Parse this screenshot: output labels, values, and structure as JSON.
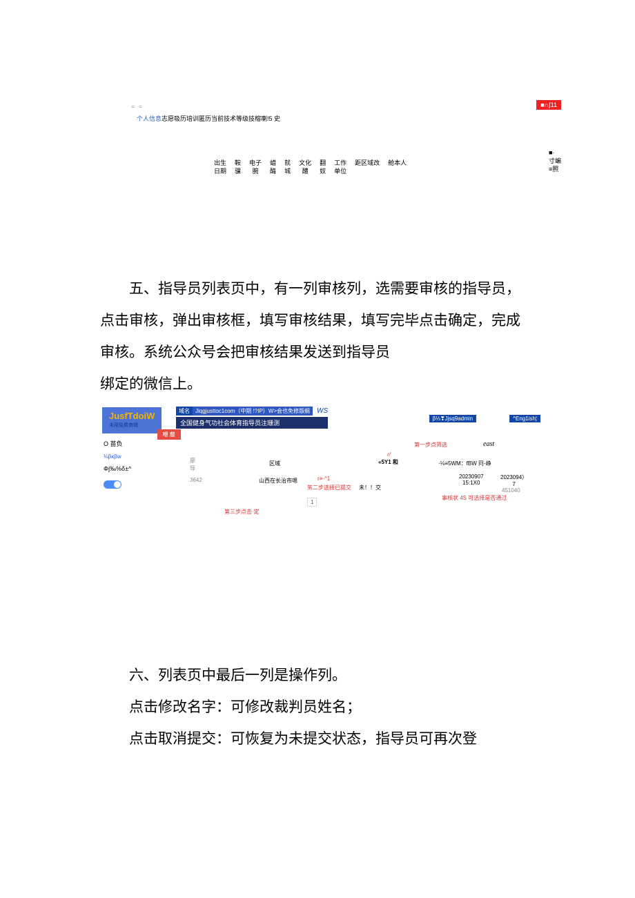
{
  "shot1": {
    "hamburger": "= =",
    "redbtn": "■∩∫11",
    "tabs": {
      "blue": "个人信息",
      "black": "志愿吸历培训匿历当前技术等级技榕喇!5 史"
    },
    "cols": [
      "出生\n日期",
      "鞍\n骒",
      "电子\n腕",
      "蜡\n酶",
      "就\n城",
      "文化\n醴",
      "翻\n奴",
      "工作\n单位",
      "距区域改",
      "舱本人"
    ],
    "right": "■·\n寸蝙\n≡照"
  },
  "para5": {
    "l1": "五、指导员列表页中，有一列审核列，选需要审核的指导员，",
    "l2": "点击审核，弹出审核框，填写审核结果，填写完毕点击确定，完成",
    "l3": "审核。系统公众号会把审核结果发送到指导员",
    "l4": "绑定的微信上。"
  },
  "shot2": {
    "logo": {
      "main": "JusfTdoiW",
      "sub": "未用免费商城"
    },
    "topbar": {
      "tag1": "域名",
      "tag2": "Jiqgjusttoc1com（中期 !?IP）W>会也免修版纲",
      "ws": "WS",
      "banner": "全国健身气功社会体育指导员注珊测"
    },
    "admin": "β⅓❣Jjsq9admin",
    "english": "^Eng1ish¦",
    "side": {
      "item1": "O 苗负",
      "refresh": "嘲 菔",
      "item2": "⅛βκβw",
      "item3": "Φj‰%δ±^",
      "cell_num": "廖\n导",
      "num": "3642"
    },
    "table": {
      "step1": "第一步点筛选",
      "east": "east",
      "rl": "r/",
      "cell5y1": "«5Y1 和",
      "region_h": "区域",
      "region_v": "山西在长治市嗯",
      "r_red": "r≡-^1",
      "step2": "笫二步选择已提交",
      "notsub": "未！！交",
      "wmfbw": "·⅛≡5WM：fBW 冋-峥",
      "d1": "20230907\n15:1X0",
      "d2": "2023094）\n7",
      "d2b": "451040",
      "audit": "事核状 4S 可选择是否通过",
      "page": "1",
      "step3": "第三步点击·定"
    }
  },
  "para6": {
    "l1": "六、列表页中最后一列是操作列。",
    "l2": "点击修改名字：可修改裁判员姓名；",
    "l3": "点击取消提交：可恢复为未提交状态，指导员可再次登"
  }
}
